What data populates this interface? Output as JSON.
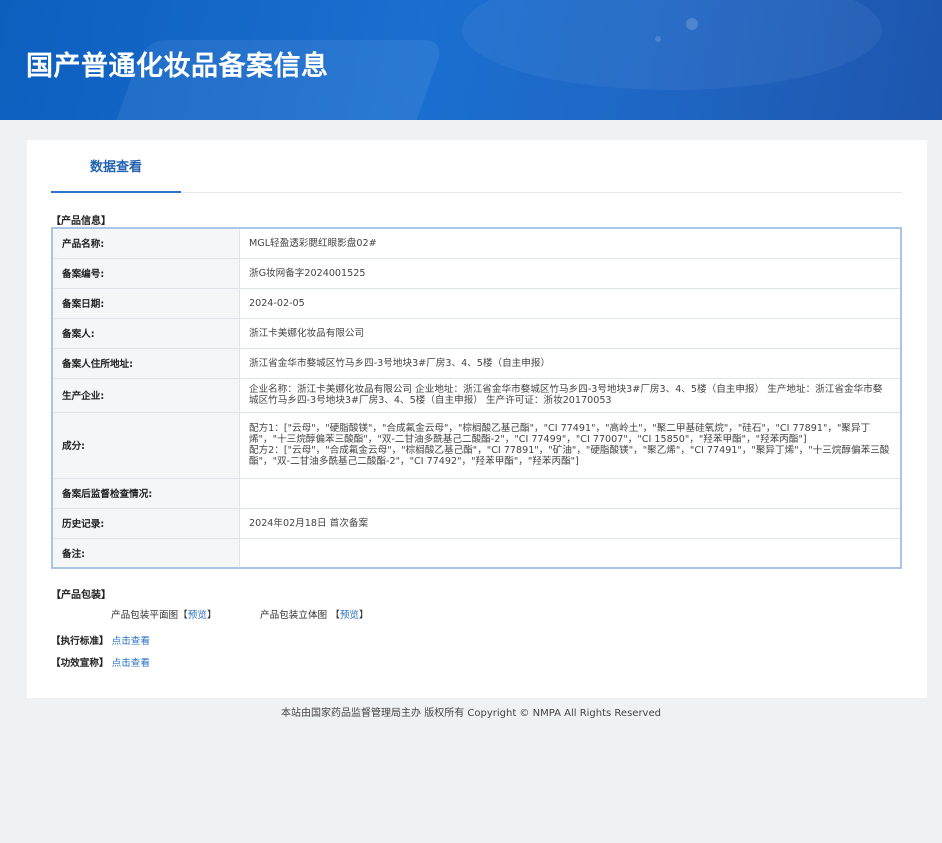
{
  "header": {
    "title": "国产普通化妆品备案信息"
  },
  "tabs": [
    {
      "label": "数据查看"
    }
  ],
  "product_info": {
    "section_title": "【产品信息】",
    "rows": [
      {
        "label": "产品名称:",
        "value": "MGL轻盈透彩腮红眼影盘02#"
      },
      {
        "label": "备案编号:",
        "value": "浙G妆网备字2024001525"
      },
      {
        "label": "备案日期:",
        "value": "2024-02-05"
      },
      {
        "label": "备案人:",
        "value": "浙江卡美娜化妆品有限公司"
      },
      {
        "label": "备案人住所地址:",
        "value": "浙江省金华市婺城区竹马乡四-3号地块3#厂房3、4、5楼（自主申报）"
      },
      {
        "label": "生产企业:",
        "value": "企业名称：浙江卡美娜化妆品有限公司 企业地址：浙江省金华市婺城区竹马乡四-3号地块3#厂房3、4、5楼（自主申报） 生产地址：浙江省金华市婺城区竹马乡四-3号地块3#厂房3、4、5楼（自主申报） 生产许可证：浙妆20170053"
      },
      {
        "label": "成分:",
        "value": "配方1：[\"云母\"，\"硬脂酸镁\"，\"合成氟金云母\"，\"棕榈酸乙基己酯\"，\"CI 77491\"，\"高岭土\"，\"聚二甲基硅氧烷\"，\"硅石\"，\"CI 77891\"，\"聚异丁烯\"，\"十三烷醇偏苯三酸酯\"，\"双-二甘油多酰基己二酸酯-2\"，\"CI 77499\"，\"CI 77007\"，\"CI 15850\"，\"羟苯甲酯\"，\"羟苯丙酯\"]",
        "value2": "配方2：[\"云母\"，\"合成氟金云母\"，\"棕榈酸乙基己酯\"，\"CI 77891\"，\"矿油\"，\"硬脂酸镁\"，\"聚乙烯\"，\"CI 77491\"，\"聚异丁烯\"，\"十三烷醇偏苯三酸酯\"，\"双-二甘油多酰基己二酸酯-2\"，\"CI 77492\"，\"羟苯甲酯\"，\"羟苯丙酯\"]"
      },
      {
        "label": "备案后监督检查情况:",
        "value": ""
      },
      {
        "label": "历史记录:",
        "value": "2024年02月18日 首次备案"
      },
      {
        "label": "备注:",
        "value": ""
      }
    ]
  },
  "packaging": {
    "section_title": "【产品包装】",
    "flat_label": "产品包装平面图【",
    "flat_link": "预览",
    "flat_close": "】",
    "stereo_label": "产品包装立体图 【",
    "stereo_link": "预览",
    "stereo_close": "】"
  },
  "standard": {
    "label": "【执行标准】",
    "link": "点击查看"
  },
  "efficacy": {
    "label": "【功效宣称】",
    "link": "点击查看"
  },
  "footer": {
    "text": "本站由国家药品监督管理局主办 版权所有 Copyright © NMPA All Rights Reserved"
  }
}
